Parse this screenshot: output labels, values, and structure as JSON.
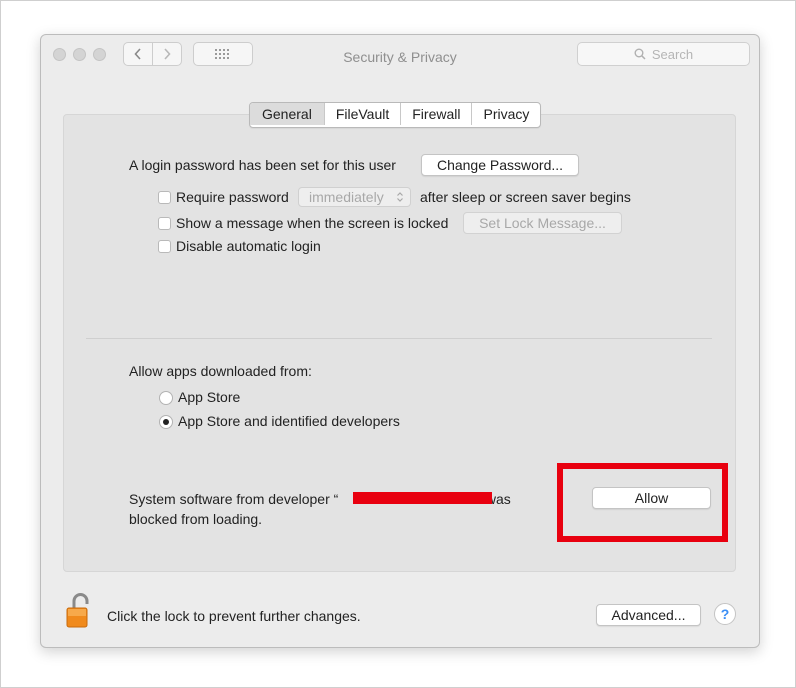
{
  "window": {
    "title": "Security & Privacy",
    "search_placeholder": "Search"
  },
  "tabs": [
    {
      "label": "General",
      "active": true
    },
    {
      "label": "FileVault",
      "active": false
    },
    {
      "label": "Firewall",
      "active": false
    },
    {
      "label": "Privacy",
      "active": false
    }
  ],
  "general": {
    "login_password_text": "A login password has been set for this user",
    "change_password_label": "Change Password...",
    "require_password_label": "Require password",
    "require_password_value": "immediately",
    "after_sleep_text": "after sleep or screen saver begins",
    "show_message_label": "Show a message when the screen is locked",
    "set_lock_message_label": "Set Lock Message...",
    "disable_auto_login_label": "Disable automatic login"
  },
  "downloads": {
    "heading": "Allow apps downloaded from:",
    "options": [
      {
        "label": "App Store",
        "selected": false
      },
      {
        "label": "App Store and identified developers",
        "selected": true
      }
    ]
  },
  "blocked": {
    "line1_prefix": "System software from developer “",
    "line1_suffix": "” was",
    "line2": "blocked from loading.",
    "allow_label": "Allow"
  },
  "footer": {
    "lock_text": "Click the lock to prevent further changes.",
    "advanced_label": "Advanced...",
    "help_label": "?"
  },
  "colors": {
    "highlight": "#e8000f",
    "redaction": "#e8000f",
    "accent": "#3a8ef6"
  }
}
